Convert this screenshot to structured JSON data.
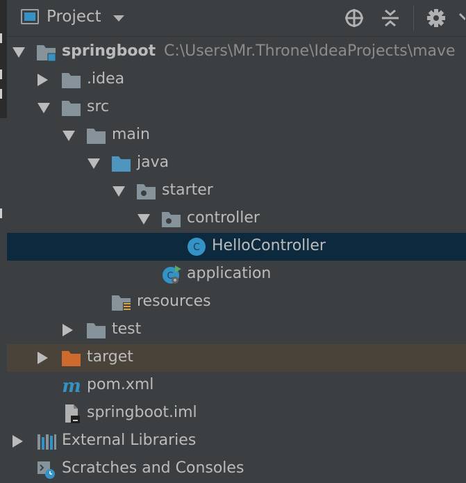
{
  "toolbar": {
    "title": "Project",
    "icons": [
      "window-icon",
      "dropdown-caret-icon",
      "locate-icon",
      "collapse-all-icon",
      "settings-gear-icon"
    ]
  },
  "tree": {
    "root": {
      "name": "springboot",
      "path": "C:\\Users\\Mr.Throne\\IdeaProjects\\mave"
    },
    "idea": ".idea",
    "src": "src",
    "main": "main",
    "java": "java",
    "starter": "starter",
    "controller": "controller",
    "hello": "HelloController",
    "application": "application",
    "resources": "resources",
    "test": "test",
    "target": "target",
    "pom": "pom.xml",
    "iml": "springboot.iml",
    "libs": "External Libraries",
    "scratches": "Scratches and Consoles"
  },
  "colors": {
    "background": "#3c3f41",
    "selected_row": "#0d293e",
    "excluded_row": "#49433a",
    "folder": "#87939a",
    "source_folder": "#4e96c0",
    "excluded_folder": "#d0692e",
    "class_icon": "#3592c4"
  }
}
